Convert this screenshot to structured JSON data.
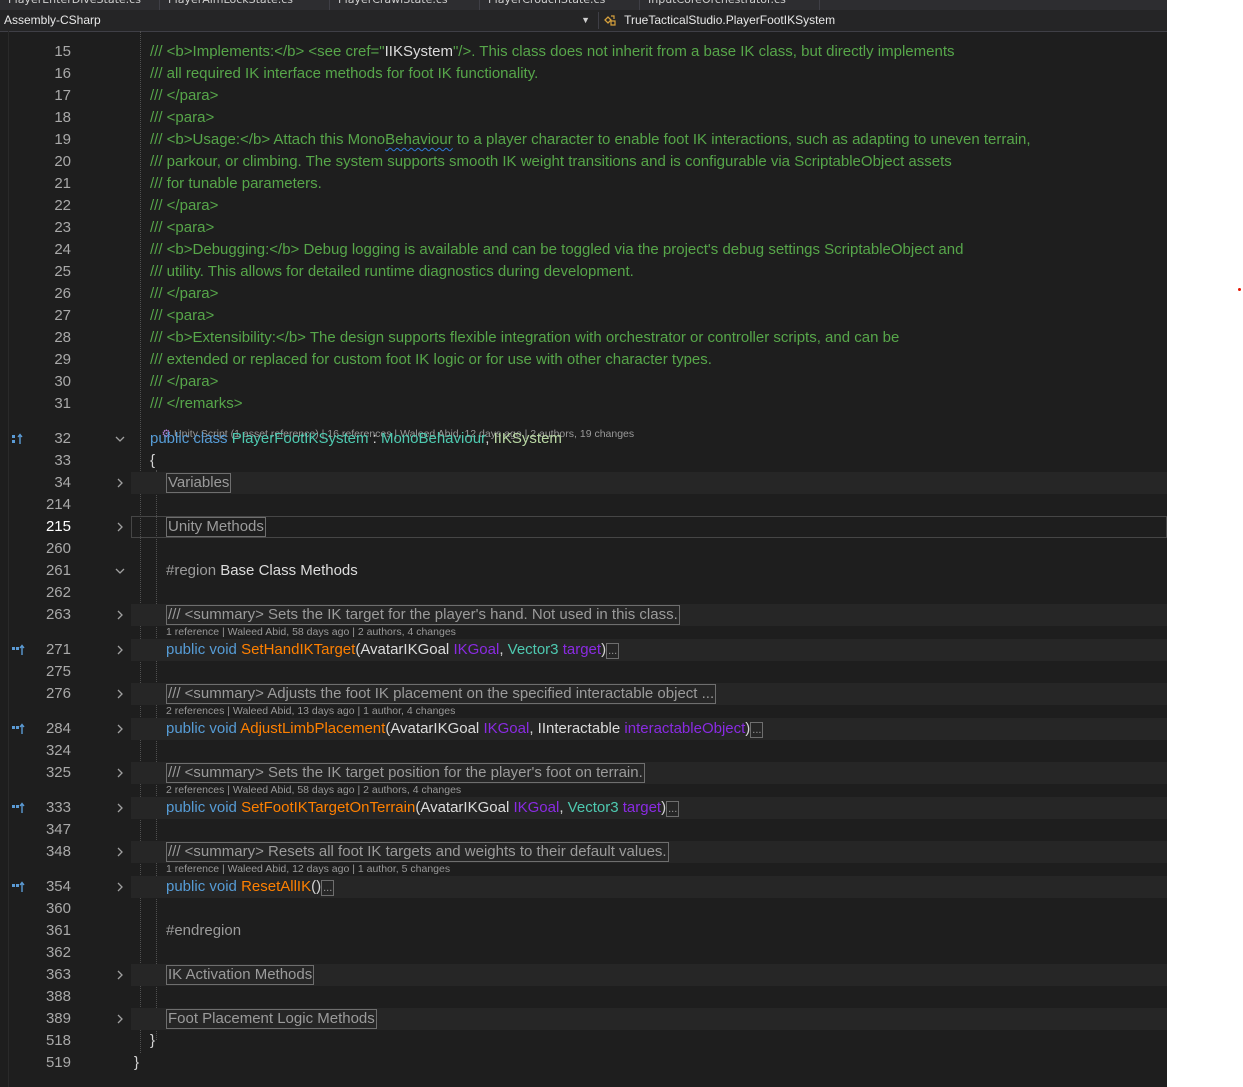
{
  "tabs": [
    "PlayerEnterDiveState.cs",
    "PlayerAimLockState.cs",
    "PlayerCrawlState.cs",
    "PlayerCrouchState.cs",
    "InputCoreOrchestrator.cs"
  ],
  "nav": {
    "project": "Assembly-CSharp",
    "type": "TrueTacticalStudio.PlayerFootIKSystem",
    "type_icon": "class-icon"
  },
  "lines": {
    "n15": "15",
    "n16": "16",
    "n17": "17",
    "n18": "18",
    "n19": "19",
    "n20": "20",
    "n21": "21",
    "n22": "22",
    "n23": "23",
    "n24": "24",
    "n25": "25",
    "n26": "26",
    "n27": "27",
    "n28": "28",
    "n29": "29",
    "n30": "30",
    "n31": "31",
    "n32": "32",
    "n33": "33",
    "n34": "34",
    "n214": "214",
    "n215": "215",
    "n260": "260",
    "n261": "261",
    "n262": "262",
    "n263": "263",
    "n271": "271",
    "n275": "275",
    "n276": "276",
    "n284": "284",
    "n324": "324",
    "n325": "325",
    "n333": "333",
    "n347": "347",
    "n348": "348",
    "n354": "354",
    "n360": "360",
    "n361": "361",
    "n362": "362",
    "n363": "363",
    "n388": "388",
    "n389": "389",
    "n518": "518",
    "n519": "519"
  },
  "code": {
    "c15a": "/// <b>Implements:</b> <see cref=\"",
    "c15b": "IIKSystem",
    "c15c": "\"/>. This class does not inherit from a base IK class, but directly implements",
    "c16": "/// all required IK interface methods for foot IK functionality.",
    "c17": "/// </para>",
    "c18": "/// <para>",
    "c19a": "/// <b>Usage:</b> Attach this Mono",
    "c19b": "Behaviour",
    "c19c": " to a player character to enable foot IK interactions, such as adapting to uneven terrain,",
    "c20": "/// parkour, or climbing. The system supports smooth IK weight transitions and is configurable via ScriptableObject assets",
    "c21": "/// for tunable parameters.",
    "c22": "/// </para>",
    "c23": "/// <para>",
    "c24": "/// <b>Debugging:</b> Debug logging is available and can be toggled via the project's debug settings ScriptableObject and",
    "c25": "/// utility. This allows for detailed runtime diagnostics during development.",
    "c26": "/// </para>",
    "c27": "/// <para>",
    "c28": "/// <b>Extensibility:</b> The design supports flexible integration with orchestrator or controller scripts, and can be",
    "c29": "/// extended or replaced for custom foot IK logic or for use with other character types.",
    "c30": "/// </para>",
    "c31": "/// </remarks>",
    "lens32": "Unity Script (1 asset reference) | 16 references | Waleed Abid, 12 days ago | 2 authors, 19 changes",
    "c32_public": "public",
    "c32_class": "class",
    "c32_name": "PlayerFootIKSystem",
    "c32_colon": " : ",
    "c32_base": "MonoBehaviour",
    "c32_comma": ", ",
    "c32_iface": "IIKSystem",
    "c33": "{",
    "r34": "Variables",
    "r215": "Unity Methods",
    "c261a": "#region",
    "c261b": " Base Class Methods",
    "s263": "/// <summary> Sets the IK target for the player's hand. Not used in this class.",
    "lens271": "1 reference | Waleed Abid, 58 days ago | 2 authors, 4 changes",
    "c271_name": "SetHandIKTarget",
    "c271_p1type": "AvatarIKGoal",
    "c271_p1": "IKGoal",
    "c271_p2type": "Vector3",
    "c271_p2": "target",
    "s276": "/// <summary> Adjusts the foot IK placement on the specified interactable object ...",
    "lens284": "2 references | Waleed Abid, 13 days ago | 1 author, 4 changes",
    "c284_name": "AdjustLimbPlacement",
    "c284_p1type": "AvatarIKGoal",
    "c284_p1": "IKGoal",
    "c284_p2type": "IInteractable",
    "c284_p2": "interactableObject",
    "s325": "/// <summary> Sets the IK target position for the player's foot on terrain.",
    "lens333": "2 references | Waleed Abid, 58 days ago | 2 authors, 4 changes",
    "c333_name": "SetFootIKTargetOnTerrain",
    "c333_p1type": "AvatarIKGoal",
    "c333_p1": "IKGoal",
    "c333_p2type": "Vector3",
    "c333_p2": "target",
    "s348": "/// <summary> Resets all foot IK targets and weights to their default values.",
    "lens354": "1 reference | Waleed Abid, 12 days ago | 1 author, 5 changes",
    "c354_name": "ResetAllIK",
    "kw_public": "public",
    "kw_void": "void",
    "c361": "#endregion",
    "r363": "IK Activation Methods",
    "r389": "Foot Placement Logic Methods",
    "c518": "}",
    "c519": "}",
    "ellipsis": "...",
    "lparen": "(",
    "rparen": ")",
    "comma": ", ",
    "space": " ",
    "emptyparens": "()"
  },
  "colors": {
    "comment": "#57a64a",
    "keyword": "#569cd6",
    "type": "#4ec9b0",
    "interface": "#b8d7a3",
    "method": "#ff8000",
    "parameter": "#8a2be2",
    "editor_bg": "#1e1e1e"
  }
}
